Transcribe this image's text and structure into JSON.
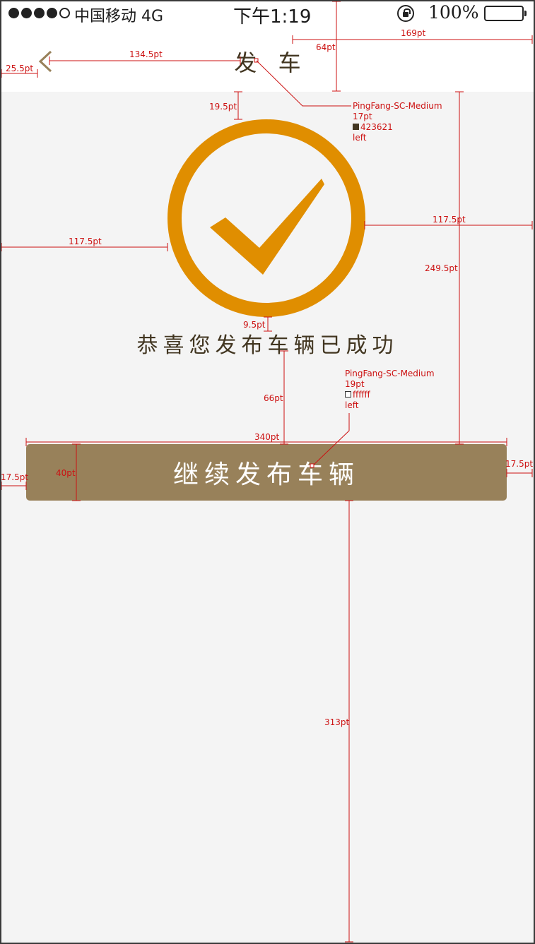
{
  "status_bar": {
    "carrier": "中国移动  4G",
    "time": "下午1:19",
    "battery": "100%"
  },
  "nav": {
    "title": "发 车",
    "back_icon": "chevron-left-icon"
  },
  "content": {
    "success_icon": "check-circle-icon",
    "success_message": "恭喜您发布车辆已成功",
    "continue_button": "继续发布车辆"
  },
  "colors": {
    "accent_orange": "#e08e00",
    "button_brown": "#98815a",
    "text_dark": "#423621",
    "background": "#f4f4f4",
    "annotation_red": "#cc1111"
  },
  "annotations": {
    "measures": {
      "back_left": "25.5pt",
      "back_to_title": "134.5pt",
      "nav_height": "64pt",
      "right_width": "169pt",
      "icon_top_gap": "19.5pt",
      "icon_left": "117.5pt",
      "icon_right": "117.5pt",
      "right_column": "249.5pt",
      "icon_to_text": "9.5pt",
      "text_to_button": "66pt",
      "button_width": "340pt",
      "button_height": "40pt",
      "button_left": "17.5pt",
      "button_right": "17.5pt",
      "bottom_space": "313pt"
    },
    "title_spec": {
      "font": "PingFang-SC-Medium",
      "size": "17pt",
      "color": "423621",
      "align": "left"
    },
    "button_spec": {
      "font": "PingFang-SC-Medium",
      "size": "19pt",
      "color": "ffffff",
      "align": "left"
    }
  }
}
